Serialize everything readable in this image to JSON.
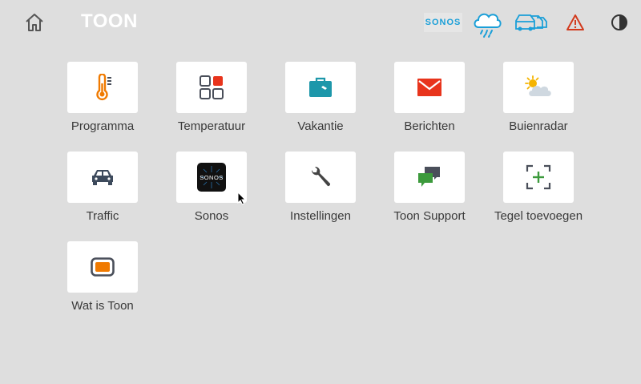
{
  "header": {
    "logo_text": "TOON",
    "sonos_label": "SONOS",
    "icons": [
      "home-icon",
      "weather-rain-icon",
      "traffic-icon",
      "warning-icon",
      "contrast-icon"
    ]
  },
  "tiles": [
    {
      "label": "Programma",
      "icon": "thermometer-icon"
    },
    {
      "label": "Temperatuur",
      "icon": "temperature-grid-icon"
    },
    {
      "label": "Vakantie",
      "icon": "suitcase-icon"
    },
    {
      "label": "Berichten",
      "icon": "envelope-icon"
    },
    {
      "label": "Buienradar",
      "icon": "sun-cloud-icon"
    },
    {
      "label": "Traffic",
      "icon": "car-icon"
    },
    {
      "label": "Sonos",
      "icon": "sonos-icon",
      "icon_text": "SONOS"
    },
    {
      "label": "Instellingen",
      "icon": "wrench-icon"
    },
    {
      "label": "Toon Support",
      "icon": "chat-bubbles-icon"
    },
    {
      "label": "Tegel toevoegen",
      "icon": "add-tile-icon"
    },
    {
      "label": "Wat is Toon",
      "icon": "toon-device-icon"
    }
  ],
  "colors": {
    "background": "#dedede",
    "tile": "#ffffff",
    "accent_orange": "#f07a00",
    "accent_blue": "#1a9fd8",
    "accent_red": "#e8341c",
    "accent_teal": "#1d97aa",
    "accent_green": "#3c9a3c",
    "icon_dark": "#4a4f5a"
  }
}
